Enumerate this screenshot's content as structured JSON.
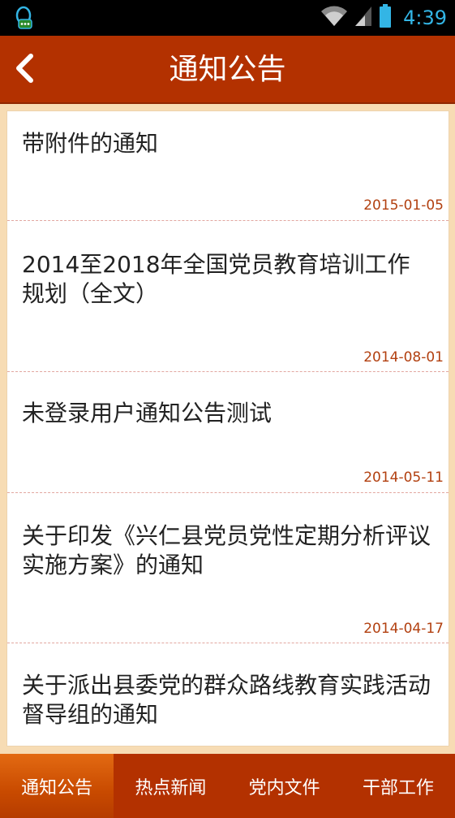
{
  "status_bar": {
    "time": "4:39",
    "icons": [
      "qq-notification-icon",
      "wifi-icon",
      "signal-icon",
      "battery-icon"
    ],
    "accent_color": "#33b5e5"
  },
  "header": {
    "title": "通知公告",
    "back_icon": "back-chevron-icon",
    "background_color": "#b33100"
  },
  "notices": [
    {
      "title": "带附件的通知",
      "date": "2015-01-05"
    },
    {
      "title": "2014至2018年全国党员教育培训工作规划（全文）",
      "date": "2014-08-01"
    },
    {
      "title": "未登录用户通知公告测试",
      "date": "2014-05-11"
    },
    {
      "title": "关于印发《兴仁县党员党性定期分析评议实施方案》的通知",
      "date": "2014-04-17"
    },
    {
      "title": "关于派出县委党的群众路线教育实践活动督导组的通知",
      "date": ""
    }
  ],
  "tabs": [
    {
      "label": "通知公告",
      "active": true
    },
    {
      "label": "热点新闻",
      "active": false
    },
    {
      "label": "党内文件",
      "active": false
    },
    {
      "label": "干部工作",
      "active": false
    }
  ],
  "colors": {
    "content_background": "#f7dcb4",
    "date_color": "#b24010",
    "active_tab": "#e36a12"
  }
}
